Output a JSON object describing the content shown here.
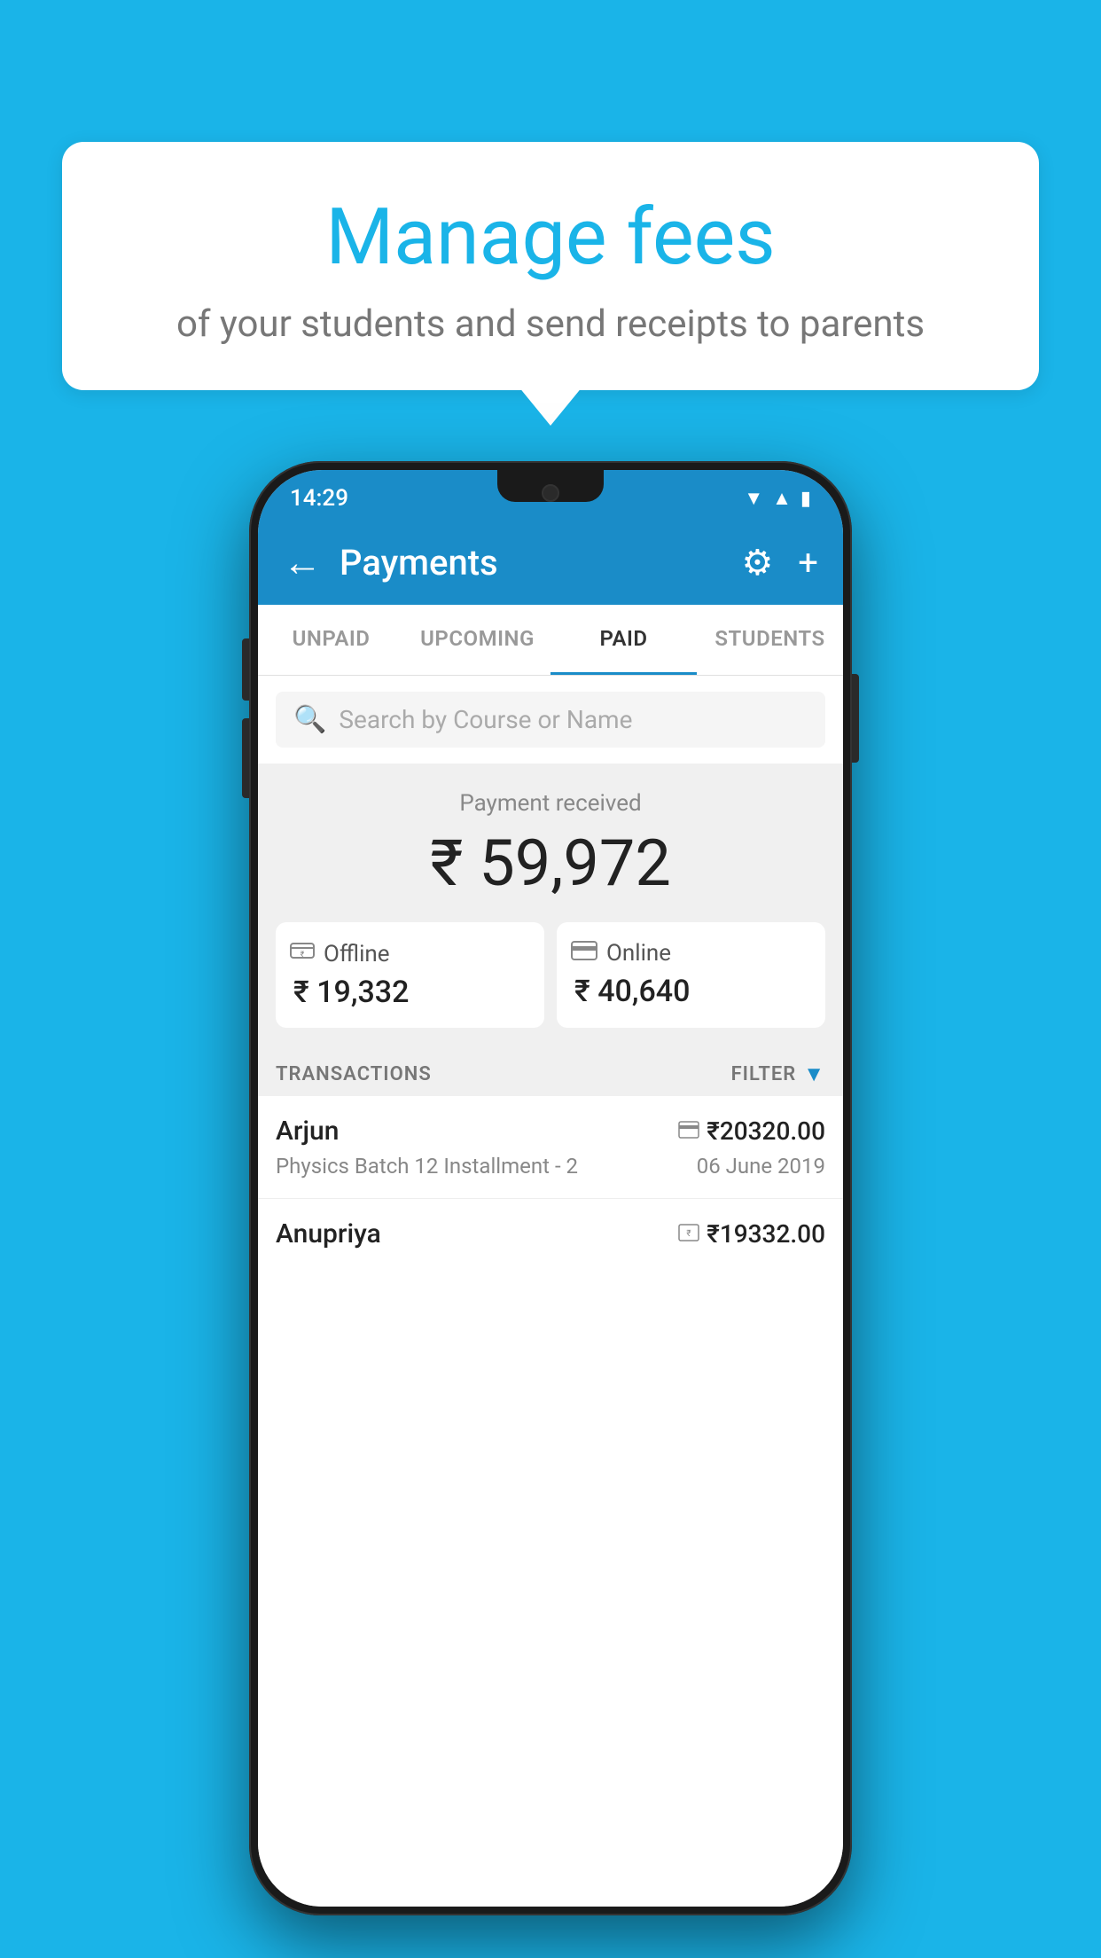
{
  "background_color": "#1ab4e8",
  "speech_bubble": {
    "title": "Manage fees",
    "subtitle": "of your students and send receipts to parents"
  },
  "status_bar": {
    "time": "14:29",
    "icons": [
      "wifi",
      "signal",
      "battery"
    ]
  },
  "app_bar": {
    "title": "Payments",
    "back_label": "←",
    "gear_label": "⚙",
    "plus_label": "+"
  },
  "tabs": [
    {
      "label": "UNPAID",
      "active": false
    },
    {
      "label": "UPCOMING",
      "active": false
    },
    {
      "label": "PAID",
      "active": true
    },
    {
      "label": "STUDENTS",
      "active": false
    }
  ],
  "search": {
    "placeholder": "Search by Course or Name"
  },
  "payment_summary": {
    "label": "Payment received",
    "amount": "₹ 59,972",
    "offline": {
      "icon": "💳",
      "label": "Offline",
      "amount": "₹ 19,332"
    },
    "online": {
      "icon": "💳",
      "label": "Online",
      "amount": "₹ 40,640"
    }
  },
  "transactions": {
    "header_label": "TRANSACTIONS",
    "filter_label": "FILTER",
    "items": [
      {
        "name": "Arjun",
        "amount": "₹20320.00",
        "course": "Physics Batch 12 Installment - 2",
        "date": "06 June 2019",
        "type": "online"
      },
      {
        "name": "Anupriya",
        "amount": "₹19332.00",
        "course": "",
        "date": "",
        "type": "offline"
      }
    ]
  }
}
